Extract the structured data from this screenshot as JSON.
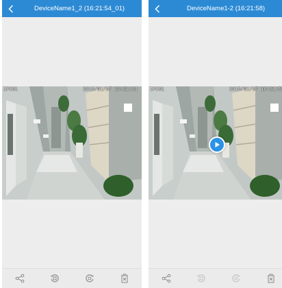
{
  "screens": [
    {
      "title": "DeviceName1_2 (16:21:54_01)",
      "video": {
        "camera_label": "IPC01",
        "timestamp": "2015/01/07 16:21:54"
      },
      "toolbar": [
        "share-icon",
        "record-icon",
        "snapshot-icon",
        "delete-icon"
      ]
    },
    {
      "title": "DeviceName1-2 (16:21:58)",
      "video": {
        "camera_label": "IPC01",
        "timestamp": "2015/01/07 16:21:58"
      },
      "play_icon": "play-icon",
      "toolbar": [
        "share-icon",
        "record-icon",
        "snapshot-icon",
        "delete-icon"
      ]
    }
  ],
  "colors": {
    "header": "#2c8ad5",
    "background": "#ededed",
    "play_button": "#2b93e6"
  }
}
